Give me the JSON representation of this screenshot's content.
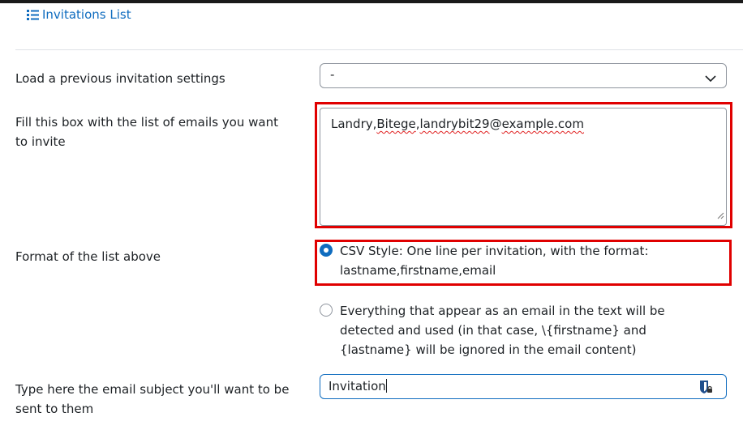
{
  "nav": {
    "invitations_list_label": "Invitations List",
    "invitations_list_icon": "list-icon"
  },
  "form": {
    "load_settings": {
      "label": "Load a previous invitation settings",
      "selected_value": "-"
    },
    "emails_box": {
      "label": "Fill this box with the list of emails you want to invite",
      "value_parts": [
        "Landry,",
        "Bitege",
        ",",
        "landrybit29",
        "@",
        "example.com"
      ]
    },
    "list_format": {
      "label": "Format of the list above",
      "options": [
        {
          "label": "CSV Style: One line per invitation, with the format: lastname,firstname,email",
          "checked": true
        },
        {
          "label": "Everything that appear as an email in the text will be detected and used (in that case, \\{firstname} and {lastname} will be ignored in the email content)",
          "checked": false
        }
      ]
    },
    "email_subject": {
      "label": "Type here the email subject you'll want to be sent to them",
      "value": "Invitation"
    }
  },
  "colors": {
    "accent": "#0f6cbf",
    "highlight": "#e00000",
    "spellcheck": "#e02020"
  }
}
